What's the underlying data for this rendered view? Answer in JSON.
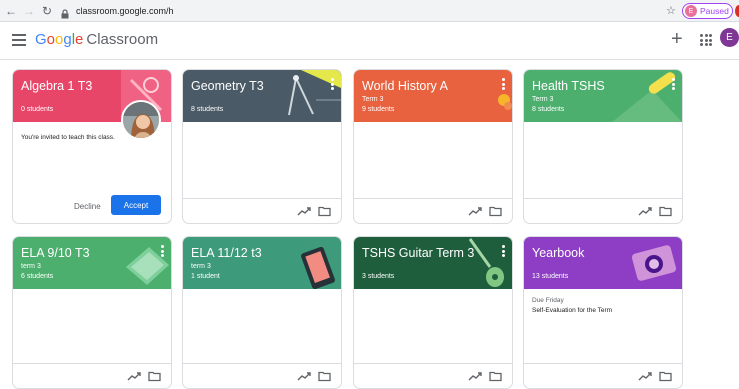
{
  "browser": {
    "url": "classroom.google.com/h",
    "profile_initial": "E",
    "profile_status": "Paused"
  },
  "app": {
    "brand_google": [
      "G",
      "o",
      "o",
      "g",
      "l",
      "e"
    ],
    "brand_product": "Classroom",
    "user_initial": "E"
  },
  "colors": {
    "algebra": "#e84669",
    "geometry": "#4a5a66",
    "world_history": "#e8623f",
    "health": "#4caf6e",
    "ela910": "#4caf6e",
    "ela1112": "#3d9a7b",
    "guitar": "#1f5e3c",
    "yearbook": "#8e3ec4",
    "accent": "#1a73e8"
  },
  "cards": {
    "algebra": {
      "title": "Algebra 1 T3",
      "count": "0 students",
      "invite": "You're invited to teach this class.",
      "decline": "Decline",
      "accept": "Accept"
    },
    "geometry": {
      "title": "Geometry T3",
      "count": "8 students"
    },
    "world_history": {
      "title": "World History A",
      "sub": "Term 3",
      "count": "9 students"
    },
    "health": {
      "title": "Health TSHS",
      "sub": "Term 3",
      "count": "8 students"
    },
    "ela910": {
      "title": "ELA 9/10 T3",
      "sub": "term 3",
      "count": "6 students"
    },
    "ela1112": {
      "title": "ELA 11/12 t3",
      "sub": "term 3",
      "count": "1 student"
    },
    "guitar": {
      "title": "TSHS Guitar Term 3",
      "count": "3 students"
    },
    "yearbook": {
      "title": "Yearbook",
      "count": "13 students",
      "due_label": "Due Friday",
      "due_item": "Self-Evaluation for the Term"
    }
  }
}
